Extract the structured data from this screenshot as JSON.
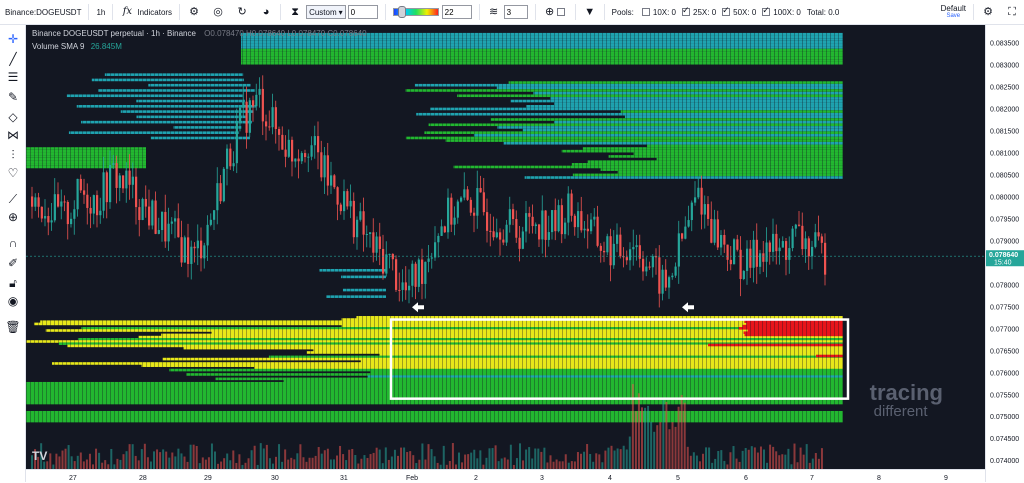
{
  "toolbar": {
    "symbol": "Binance:DOGEUSDT",
    "interval": "1h",
    "indicators_label": "Indicators",
    "custom_select": "Custom",
    "custom_value": "0",
    "gradient_value": "22",
    "layers_value": "3",
    "pools_label": "Pools:",
    "pool_10x": "10X: 0",
    "pool_25x": "25X: 0",
    "pool_50x": "50X: 0",
    "pool_100x": "100X: 0",
    "total": "Total: 0.0",
    "layout_name": "Default",
    "save_label": "Save"
  },
  "legend": {
    "title": "Binance DOGEUSDT perpetual · 1h · Binance",
    "ohlc": "O0.078470  H0.078640  L0.078470  C0.078640",
    "volume_label": "Volume SMA 9",
    "volume_value": "26.845M"
  },
  "price_axis": {
    "labels": [
      "0.083500",
      "0.083000",
      "0.082500",
      "0.082000",
      "0.081500",
      "0.081000",
      "0.080500",
      "0.080000",
      "0.079500",
      "0.079000",
      "0.078500",
      "0.078000",
      "0.077500",
      "0.077000",
      "0.076500",
      "0.076000",
      "0.075500",
      "0.075000",
      "0.074500",
      "0.074000"
    ],
    "current_price": "0.078640",
    "countdown": "15:40",
    "current_color": "#26a69a"
  },
  "time_axis": {
    "labels": [
      "27",
      "28",
      "29",
      "30",
      "31",
      "Feb",
      "2",
      "3",
      "4",
      "5",
      "6",
      "7",
      "8",
      "9"
    ]
  },
  "watermark": {
    "line1": "tracing",
    "line2": "different"
  },
  "colors": {
    "background": "#131722",
    "bull": "#26a69a",
    "bear": "#ef5350",
    "liq_green": "#22b830",
    "liq_yellow": "#e8e81a",
    "liq_teal": "#1fa3b0",
    "liq_red": "#e8141a",
    "highlight_box": "#ffffff"
  },
  "chart_data": {
    "type": "candlestick-heatmap",
    "title": "Binance DOGEUSDT perpetual · 1h · Binance",
    "ylim": [
      0.0738,
      0.0839
    ],
    "x_labels": [
      "27",
      "28",
      "29",
      "30",
      "31",
      "Feb",
      "2",
      "3",
      "4",
      "5",
      "6",
      "7",
      "8",
      "9"
    ],
    "close_series": [
      0.08,
      0.0797,
      0.0795,
      0.0801,
      0.0799,
      0.0805,
      0.0802,
      0.0797,
      0.0793,
      0.079,
      0.0786,
      0.0795,
      0.0808,
      0.0818,
      0.0822,
      0.0815,
      0.081,
      0.0813,
      0.0805,
      0.08,
      0.0794,
      0.0788,
      0.0785,
      0.0778,
      0.0784,
      0.0793,
      0.0797,
      0.0799,
      0.0796,
      0.0794,
      0.0792,
      0.0795,
      0.0793,
      0.0797,
      0.0794,
      0.0789,
      0.0787,
      0.079,
      0.0784,
      0.0779,
      0.079,
      0.0801,
      0.0792,
      0.0787,
      0.0784,
      0.0789,
      0.0787,
      0.0791,
      0.0788,
      0.0786
    ],
    "liquidation_zones": [
      {
        "from": 0.0753,
        "to": 0.0773,
        "dominant": "yellow"
      },
      {
        "from": 0.0804,
        "to": 0.0826,
        "dominant": "green"
      },
      {
        "from": 0.083,
        "to": 0.0837,
        "dominant": "green"
      },
      {
        "from": 0.0807,
        "to": 0.0811,
        "dominant": "green"
      },
      {
        "from": 0.0749,
        "to": 0.0751,
        "dominant": "green"
      }
    ],
    "highlight_zone": {
      "from": 0.0754,
      "to": 0.0772
    },
    "volume_sma": "26.845M"
  }
}
